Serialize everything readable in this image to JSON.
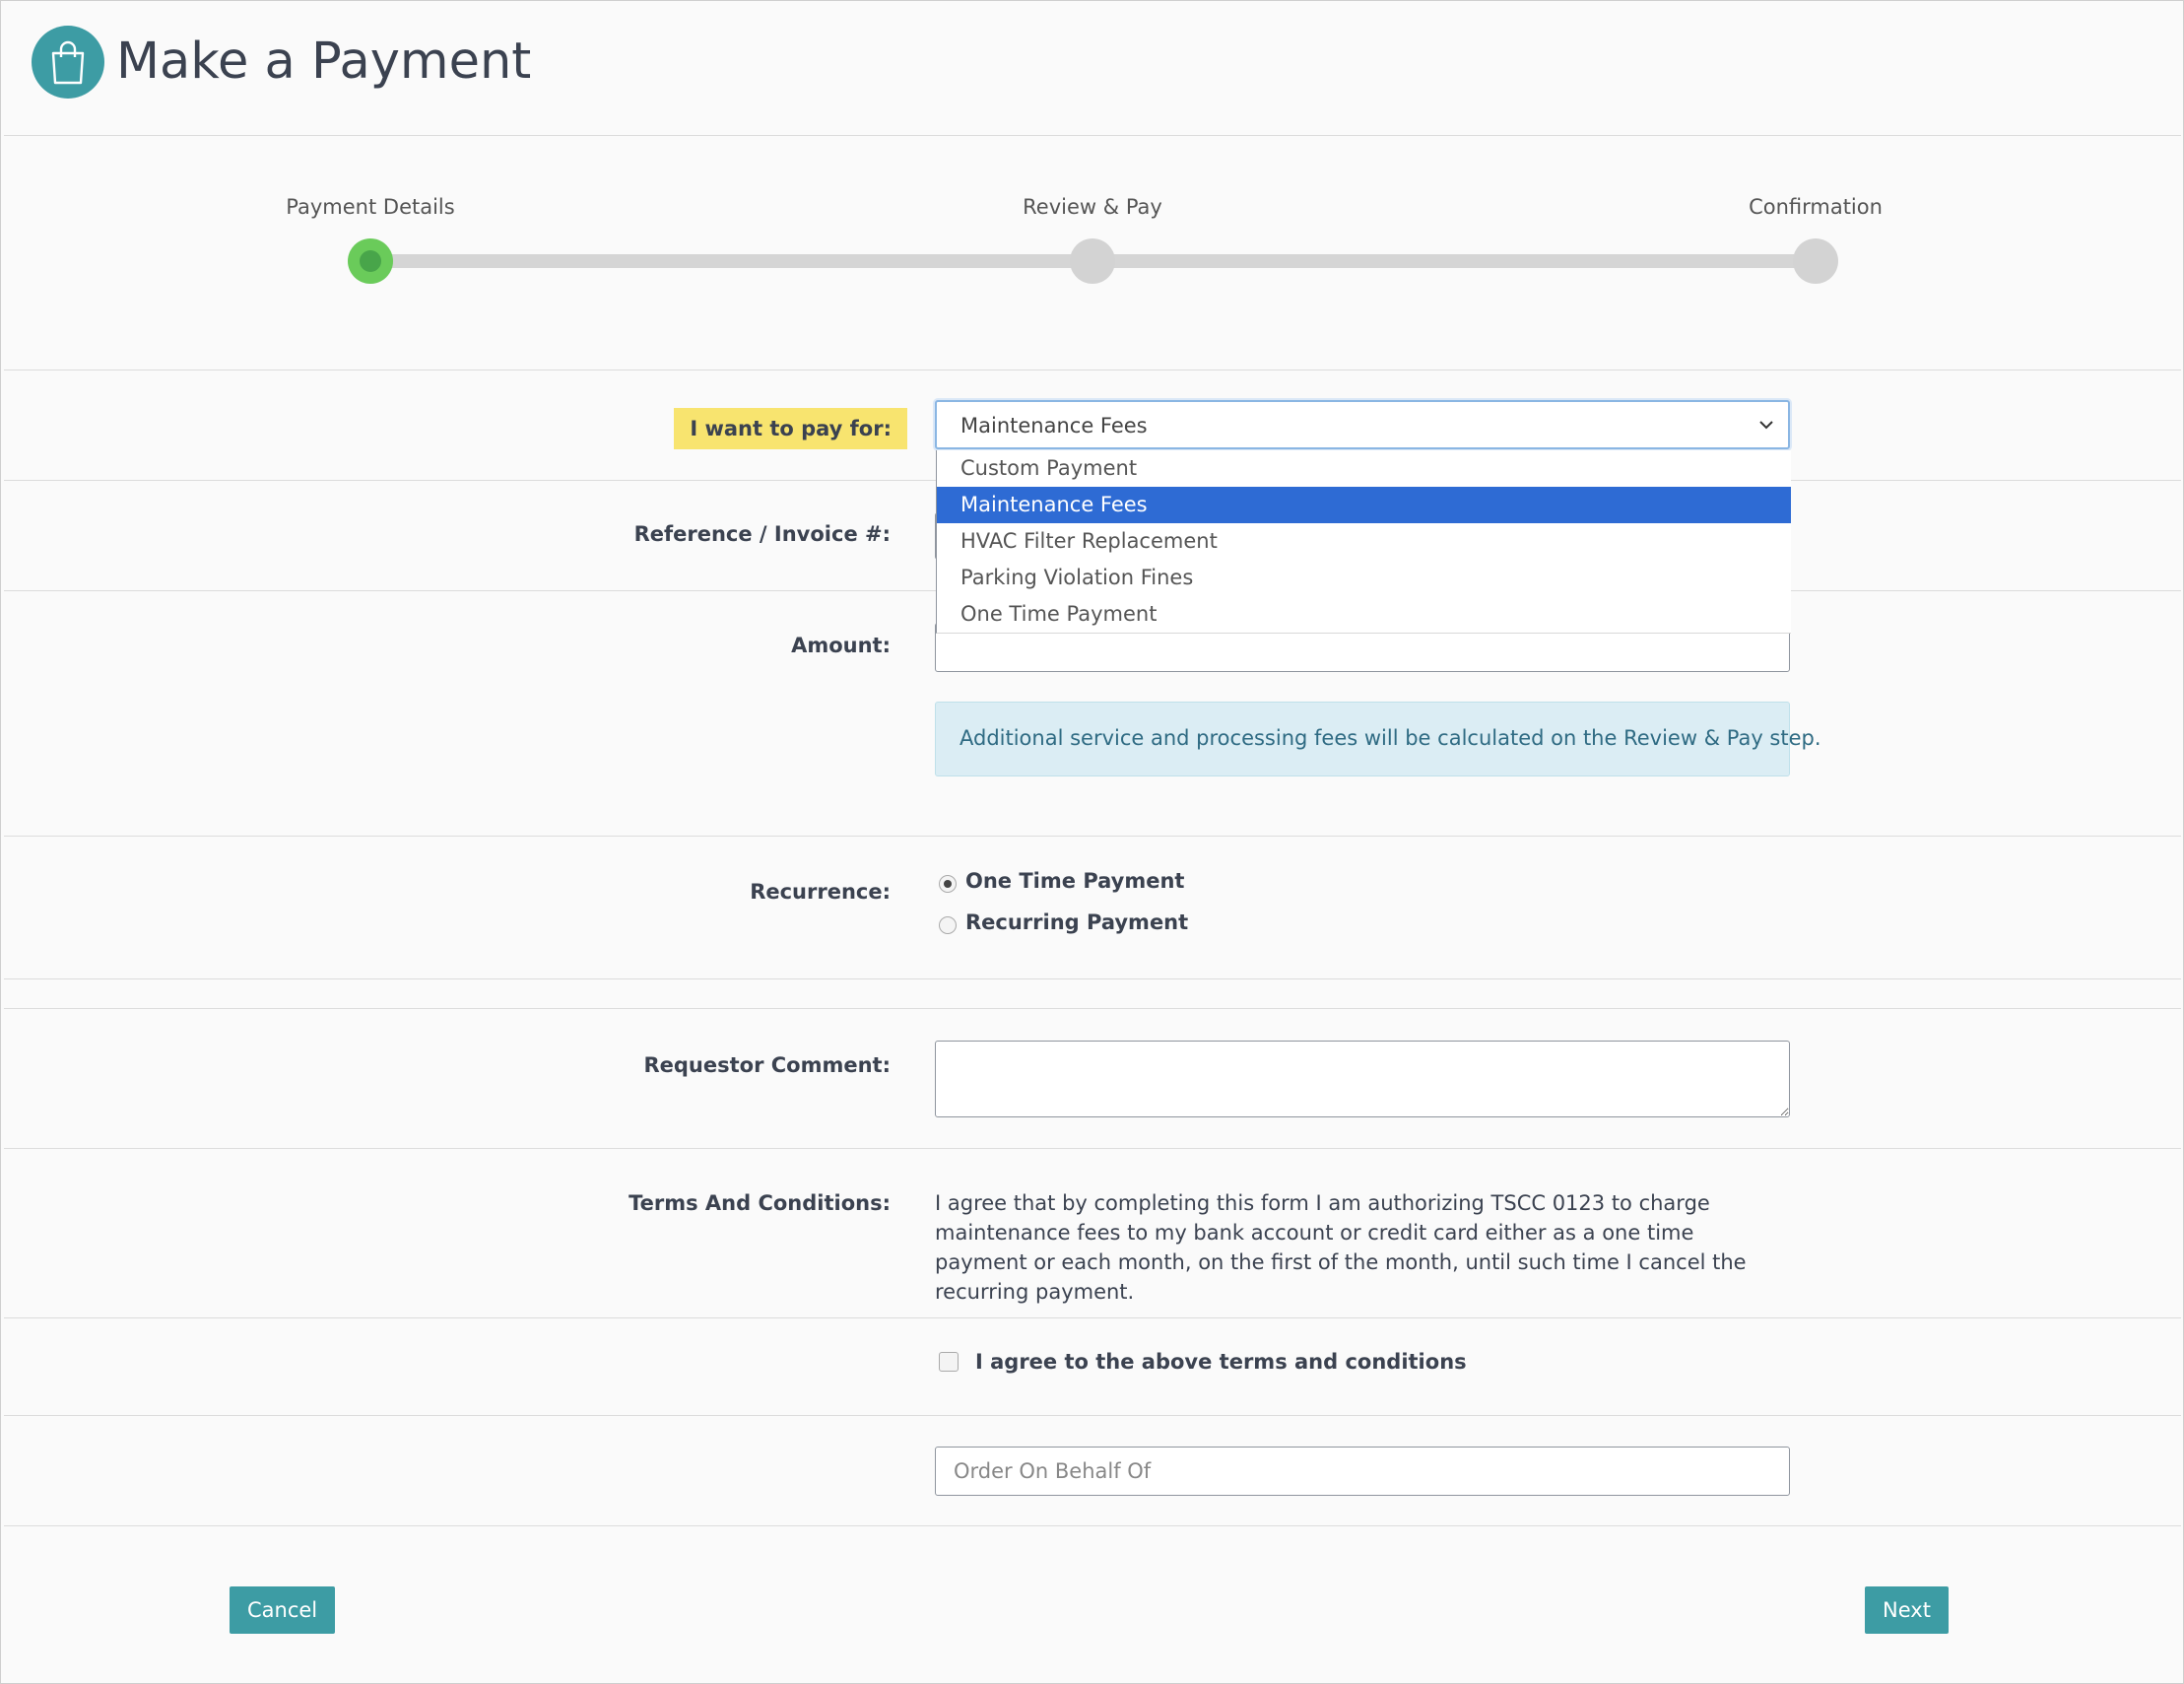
{
  "header": {
    "title": "Make a Payment",
    "icon": "shopping-bag-icon",
    "brand_color": "#3d9ca4"
  },
  "stepper": {
    "steps": [
      {
        "label": "Payment Details",
        "active": true
      },
      {
        "label": "Review & Pay",
        "active": false
      },
      {
        "label": "Confirmation",
        "active": false
      }
    ],
    "active_color": "#6acb5a"
  },
  "form": {
    "pay_for": {
      "label": "I want to pay for:",
      "value": "Maintenance Fees",
      "options": [
        "Custom Payment",
        "Maintenance Fees",
        "HVAC Filter Replacement",
        "Parking Violation Fines",
        "One Time Payment"
      ],
      "highlighted_option": "Maintenance Fees"
    },
    "reference_label": "Reference / Invoice #:",
    "amount_label": "Amount:",
    "fees_notice": "Additional service and processing fees will be calculated on the Review & Pay step.",
    "recurrence": {
      "label": "Recurrence:",
      "options": [
        {
          "label": "One Time Payment",
          "checked": true
        },
        {
          "label": "Recurring Payment",
          "checked": false
        }
      ]
    },
    "comment_label": "Requestor Comment:",
    "terms_label": "Terms And Conditions:",
    "terms_text": "I agree that by completing this form I am authorizing TSCC 0123 to charge maintenance fees to my bank account or credit card either as a one time payment or each month, on the first of the month, until such time I cancel the recurring payment.",
    "agree_label": "I agree to the above terms and conditions",
    "agree_checked": false,
    "behalf_placeholder": "Order On Behalf Of"
  },
  "buttons": {
    "cancel": "Cancel",
    "next": "Next"
  }
}
